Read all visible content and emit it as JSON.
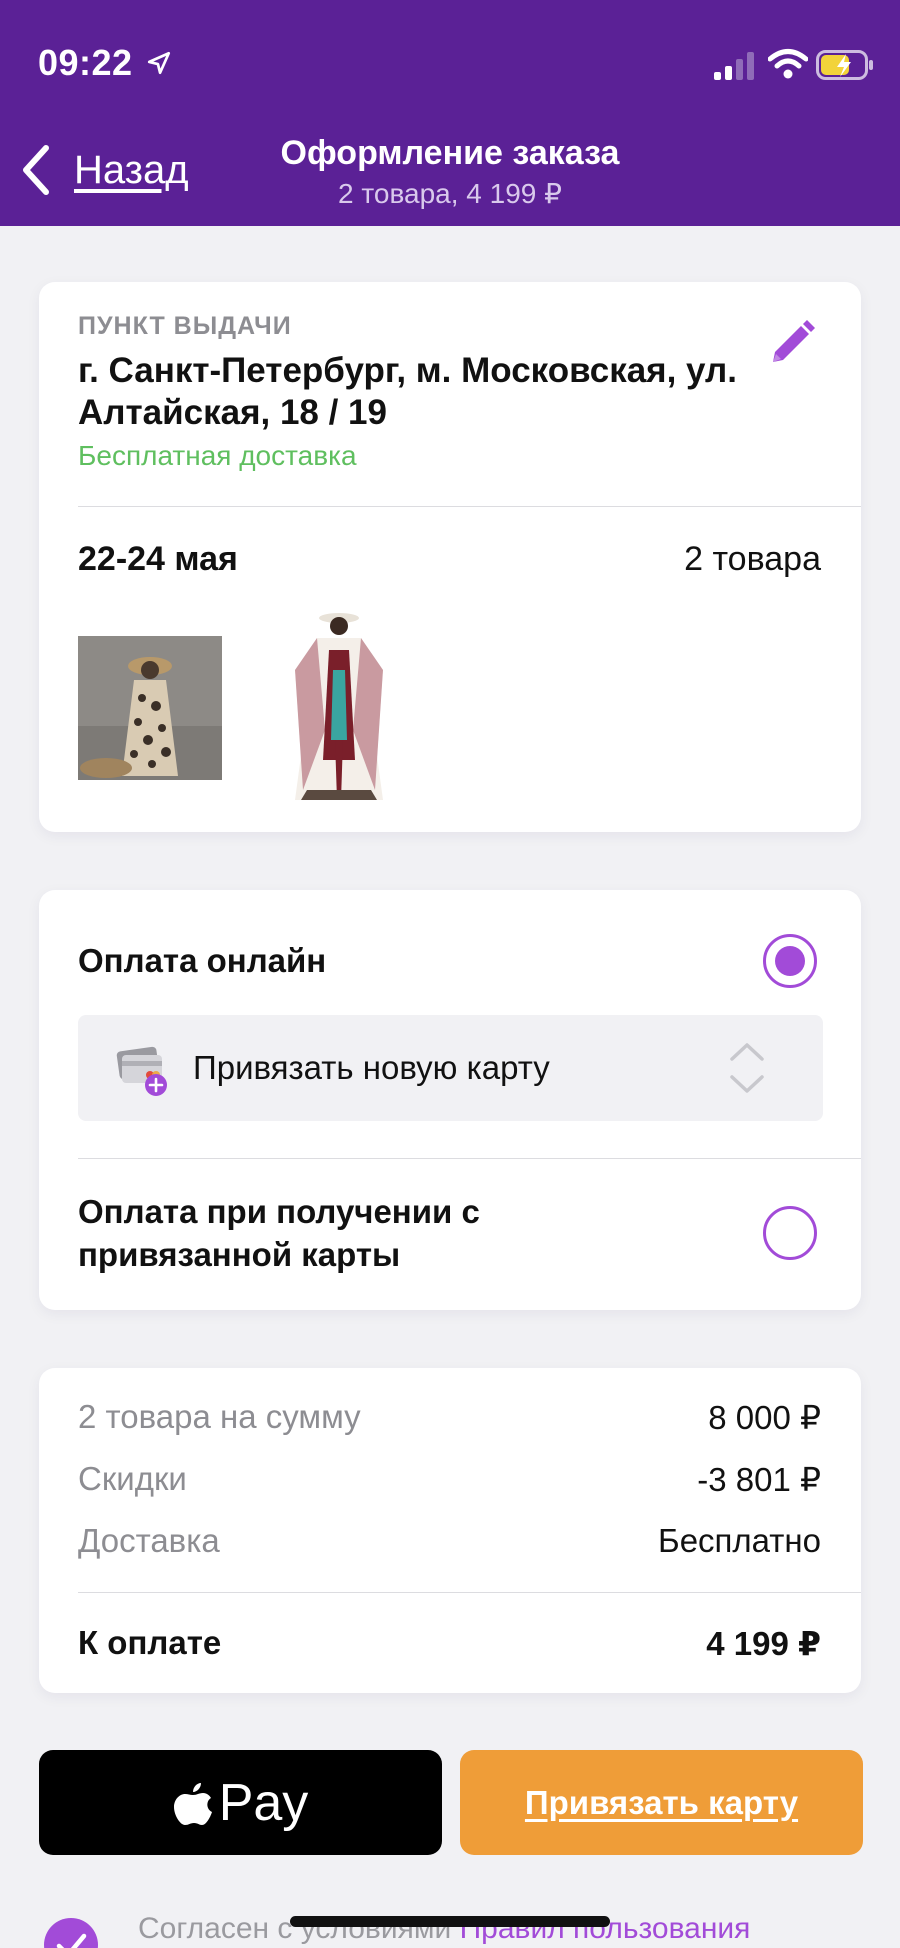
{
  "status_bar": {
    "time": "09:22"
  },
  "header": {
    "back_label": "Назад",
    "title": "Оформление заказа",
    "subtitle": "2 товара, 4 199 ₽"
  },
  "delivery": {
    "pickup_label": "ПУНКТ ВЫДАЧИ",
    "address": "г. Санкт-Петербург, м. Московская, ул. Алтайская, 18 / 19",
    "delivery_note": "Бесплатная доставка",
    "date": "22-24 мая",
    "items_count": "2 товара"
  },
  "payment": {
    "online_label": "Оплата онлайн",
    "online_selected": true,
    "card_select_label": "Привязать новую карту",
    "on_receive_label": "Оплата при получении с привязанной карты",
    "on_receive_selected": false
  },
  "summary": {
    "rows": [
      {
        "label": "2 товара на сумму",
        "value": "8 000 ₽"
      },
      {
        "label": "Скидки",
        "value": "-3 801 ₽"
      },
      {
        "label": "Доставка",
        "value": "Бесплатно"
      }
    ],
    "total_label": "К оплате",
    "total_value": "4 199 ₽"
  },
  "buttons": {
    "apple_pay_label": "Pay",
    "bind_card_label": "Привязать карту"
  },
  "agreement": {
    "text": "Согласен с условиями ",
    "link": "Правил пользования"
  },
  "colors": {
    "header_bg": "#5b2196",
    "accent": "#a24bd8",
    "free_delivery": "#5fbf5f",
    "bind_card_button": "#ef9d38"
  }
}
